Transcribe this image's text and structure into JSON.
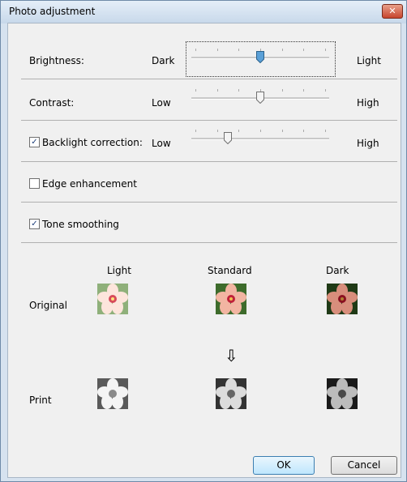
{
  "window": {
    "title": "Photo adjustment",
    "close_glyph": "✕"
  },
  "brightness": {
    "label": "Brightness:",
    "low": "Dark",
    "high": "Light",
    "value": 0.5
  },
  "contrast": {
    "label": "Contrast:",
    "low": "Low",
    "high": "High",
    "value": 0.5
  },
  "backlight": {
    "label": "Backlight correction:",
    "checked": true,
    "low": "Low",
    "high": "High",
    "value": 0.25
  },
  "edge": {
    "label": "Edge enhancement",
    "checked": false
  },
  "tone": {
    "label": "Tone smoothing",
    "checked": true
  },
  "preview": {
    "columns": [
      "Light",
      "Standard",
      "Dark"
    ],
    "rows": [
      "Original",
      "Print"
    ],
    "arrow": "⇩"
  },
  "buttons": {
    "ok": "OK",
    "cancel": "Cancel"
  },
  "colors": {
    "slider_thumb": "#5aa0d8",
    "petal_light": "#f7c9b8",
    "petal_dark": "#d88e7c",
    "flower_center": "#c0203a",
    "leaf": "#3d6b2b"
  }
}
